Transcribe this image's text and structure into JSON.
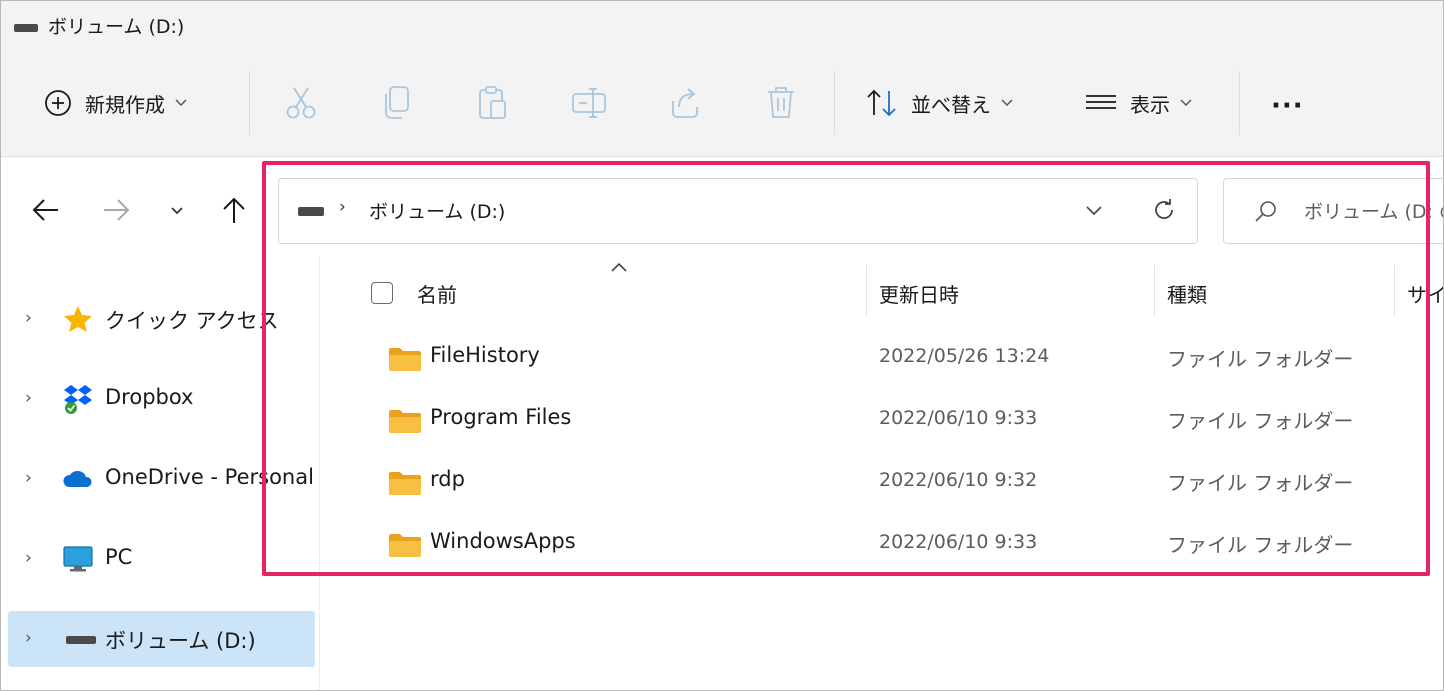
{
  "window": {
    "title": "ボリューム (D:)"
  },
  "toolbar": {
    "new_label": "新規作成",
    "sort_label": "並べ替え",
    "view_label": "表示",
    "more_label": "···"
  },
  "address": {
    "separator": "›",
    "path": "ボリューム (D:)"
  },
  "search": {
    "placeholder": "ボリューム (D: の"
  },
  "sidebar": {
    "items": [
      {
        "label": "クイック アクセス",
        "icon": "star-icon"
      },
      {
        "label": "Dropbox",
        "icon": "dropbox-icon"
      },
      {
        "label": "OneDrive - Personal",
        "icon": "onedrive-cloud-icon"
      },
      {
        "label": "PC",
        "icon": "monitor-icon"
      },
      {
        "label": "ボリューム (D:)",
        "icon": "drive-icon",
        "selected": true
      }
    ]
  },
  "columns": {
    "name": "名前",
    "date": "更新日時",
    "type": "種類",
    "size": "サイ"
  },
  "files": [
    {
      "name": "FileHistory",
      "date": "2022/05/26 13:24",
      "type": "ファイル フォルダー"
    },
    {
      "name": "Program Files",
      "date": "2022/06/10 9:33",
      "type": "ファイル フォルダー"
    },
    {
      "name": "rdp",
      "date": "2022/06/10 9:32",
      "type": "ファイル フォルダー"
    },
    {
      "name": "WindowsApps",
      "date": "2022/06/10 9:33",
      "type": "ファイル フォルダー"
    }
  ],
  "colors": {
    "highlight": "#e8245f",
    "selection": "#cce4f7",
    "folder": "#f8c043"
  }
}
